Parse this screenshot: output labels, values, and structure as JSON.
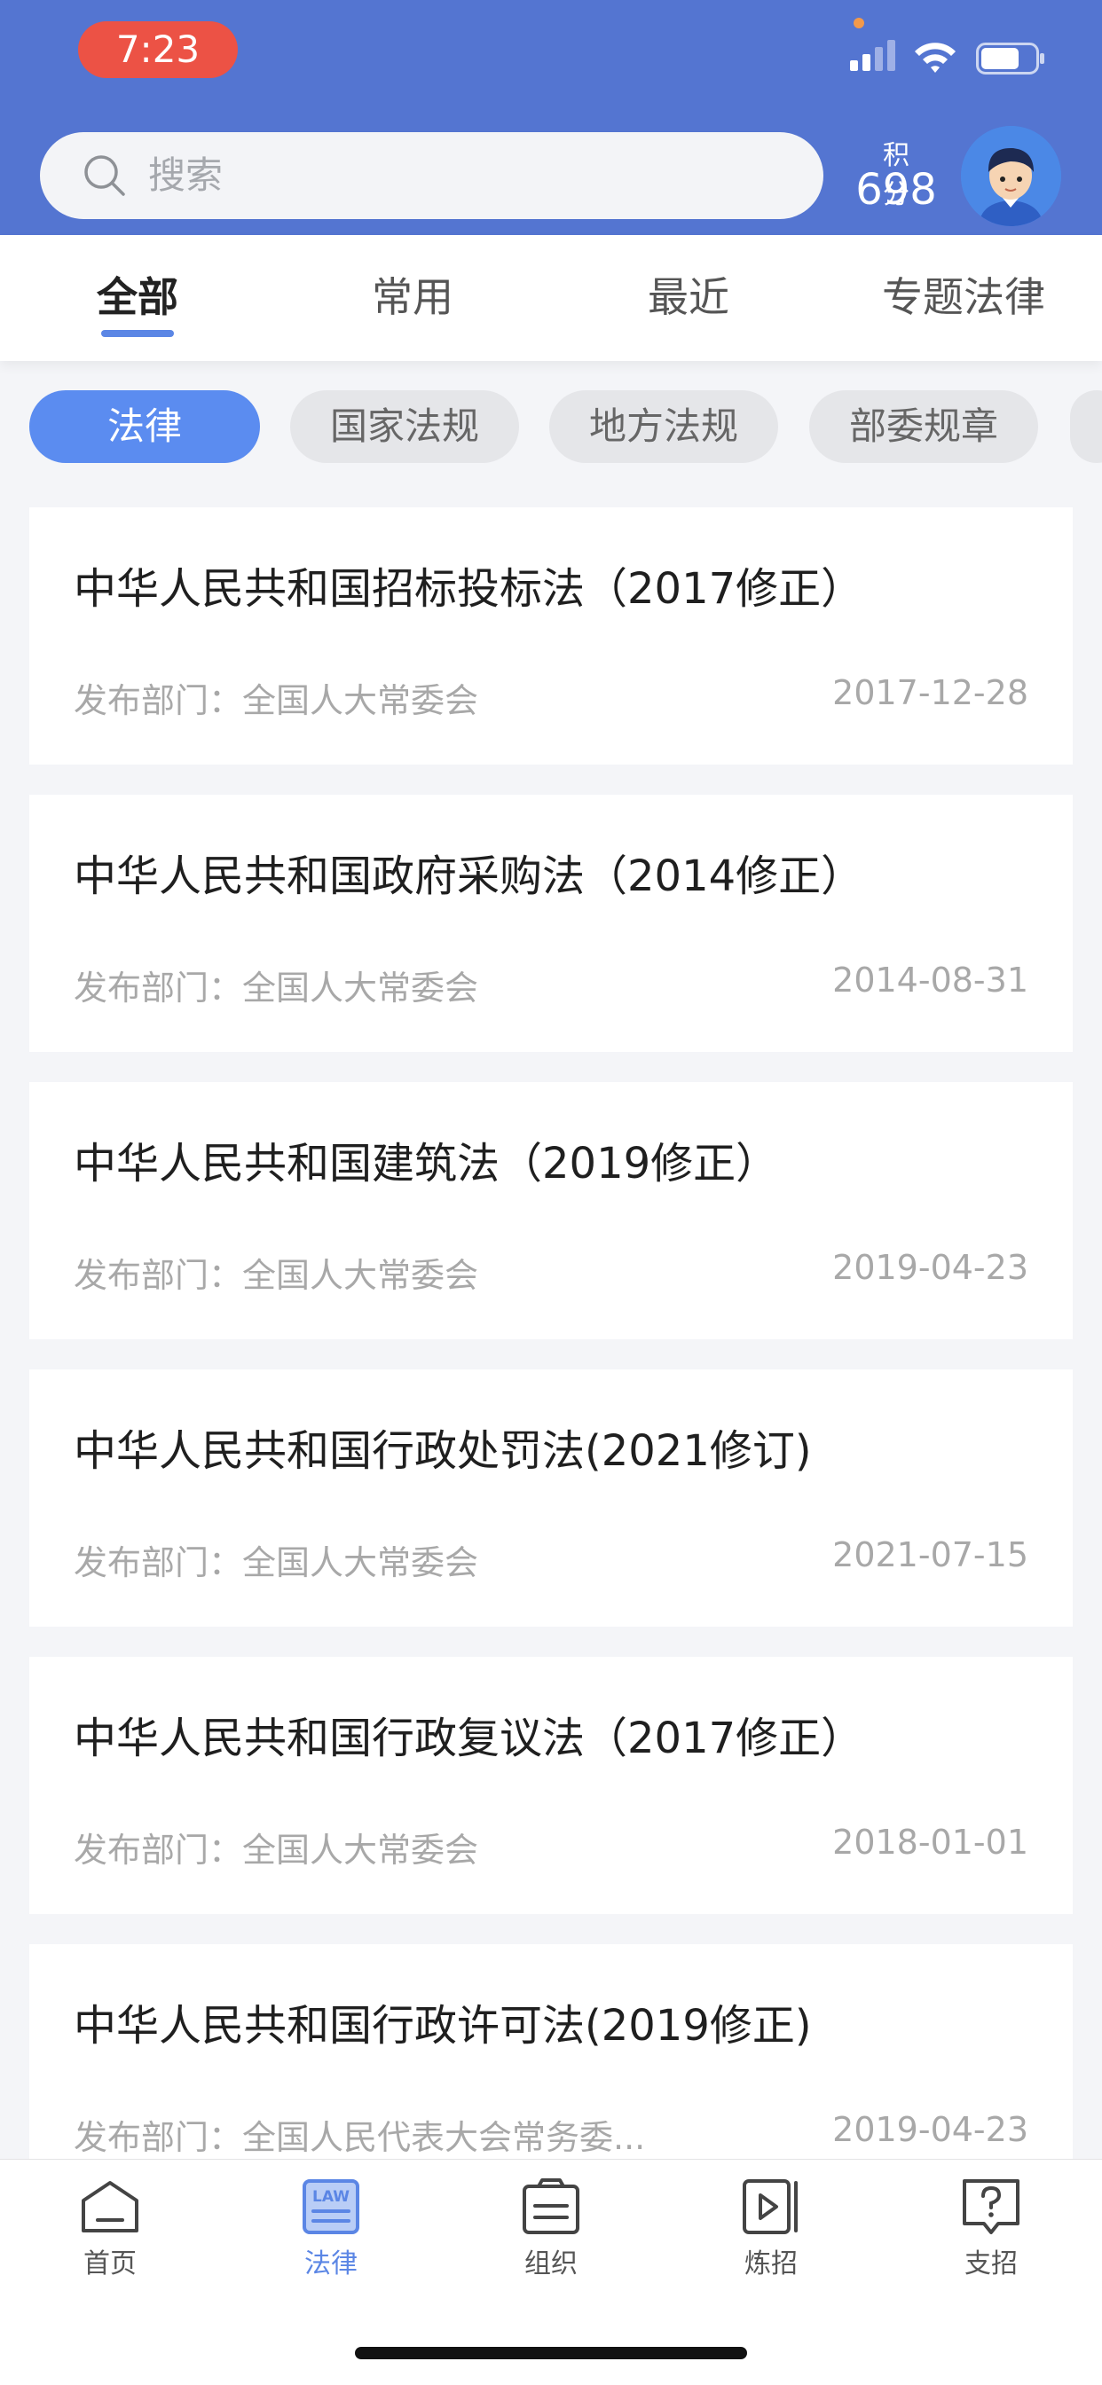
{
  "status_bar": {
    "time": "7:23"
  },
  "search": {
    "placeholder": "搜索"
  },
  "points": {
    "label": "积分",
    "value": "698"
  },
  "tabs": [
    {
      "label": "全部",
      "active": true
    },
    {
      "label": "常用",
      "active": false
    },
    {
      "label": "最近",
      "active": false
    },
    {
      "label": "专题法律",
      "active": false
    }
  ],
  "filters": [
    {
      "label": "法律",
      "active": true
    },
    {
      "label": "国家法规",
      "active": false
    },
    {
      "label": "地方法规",
      "active": false
    },
    {
      "label": "部委规章",
      "active": false
    }
  ],
  "laws": [
    {
      "title": "中华人民共和国招标投标法（2017修正）",
      "dept": "发布部门：全国人大常委会",
      "date": "2017-12-28"
    },
    {
      "title": "中华人民共和国政府采购法（2014修正）",
      "dept": "发布部门：全国人大常委会",
      "date": "2014-08-31"
    },
    {
      "title": "中华人民共和国建筑法（2019修正）",
      "dept": "发布部门：全国人大常委会",
      "date": "2019-04-23"
    },
    {
      "title": "中华人民共和国行政处罚法(2021修订)",
      "dept": "发布部门：全国人大常委会",
      "date": "2021-07-15"
    },
    {
      "title": "中华人民共和国行政复议法（2017修正）",
      "dept": "发布部门：全国人大常委会",
      "date": "2018-01-01"
    },
    {
      "title": "中华人民共和国行政许可法(2019修正)",
      "dept": "发布部门：全国人民代表大会常务委...",
      "date": "2019-04-23"
    }
  ],
  "nav": [
    {
      "label": "首页",
      "icon": "home-icon",
      "active": false
    },
    {
      "label": "法律",
      "icon": "law-book-icon",
      "icon_text": "LAW",
      "active": true
    },
    {
      "label": "组织",
      "icon": "organization-icon",
      "active": false
    },
    {
      "label": "炼招",
      "icon": "video-play-icon",
      "active": false
    },
    {
      "label": "支招",
      "icon": "question-chat-icon",
      "active": false
    }
  ],
  "colors": {
    "header_blue": "#5475d1",
    "accent_blue": "#5b86e5",
    "time_pill_red": "#ec5245"
  }
}
